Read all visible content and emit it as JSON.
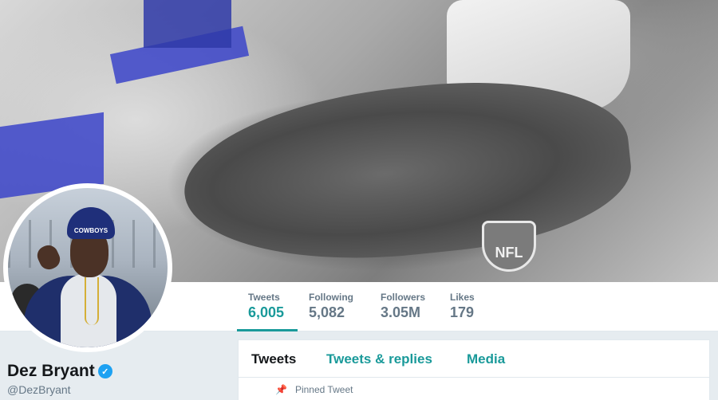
{
  "banner": {
    "nfl_logo_text": "NFL"
  },
  "avatar": {
    "hat_text": "COWBOYS"
  },
  "profile": {
    "name": "Dez Bryant",
    "handle": "@DezBryant",
    "verified_icon": "verified-check-icon"
  },
  "stats": [
    {
      "label": "Tweets",
      "value": "6,005",
      "active": true
    },
    {
      "label": "Following",
      "value": "5,082",
      "active": false
    },
    {
      "label": "Followers",
      "value": "3.05M",
      "active": false
    },
    {
      "label": "Likes",
      "value": "179",
      "active": false
    }
  ],
  "timeline": {
    "tabs": [
      {
        "label": "Tweets",
        "active": true
      },
      {
        "label": "Tweets & replies",
        "active": false
      },
      {
        "label": "Media",
        "active": false
      }
    ],
    "pinned_icon": "pin-icon",
    "pinned_label": "Pinned Tweet"
  },
  "colors": {
    "accent": "#1a9a9a",
    "verified": "#1da1f2",
    "muted_text": "#657786",
    "background": "#e6ecf0"
  }
}
